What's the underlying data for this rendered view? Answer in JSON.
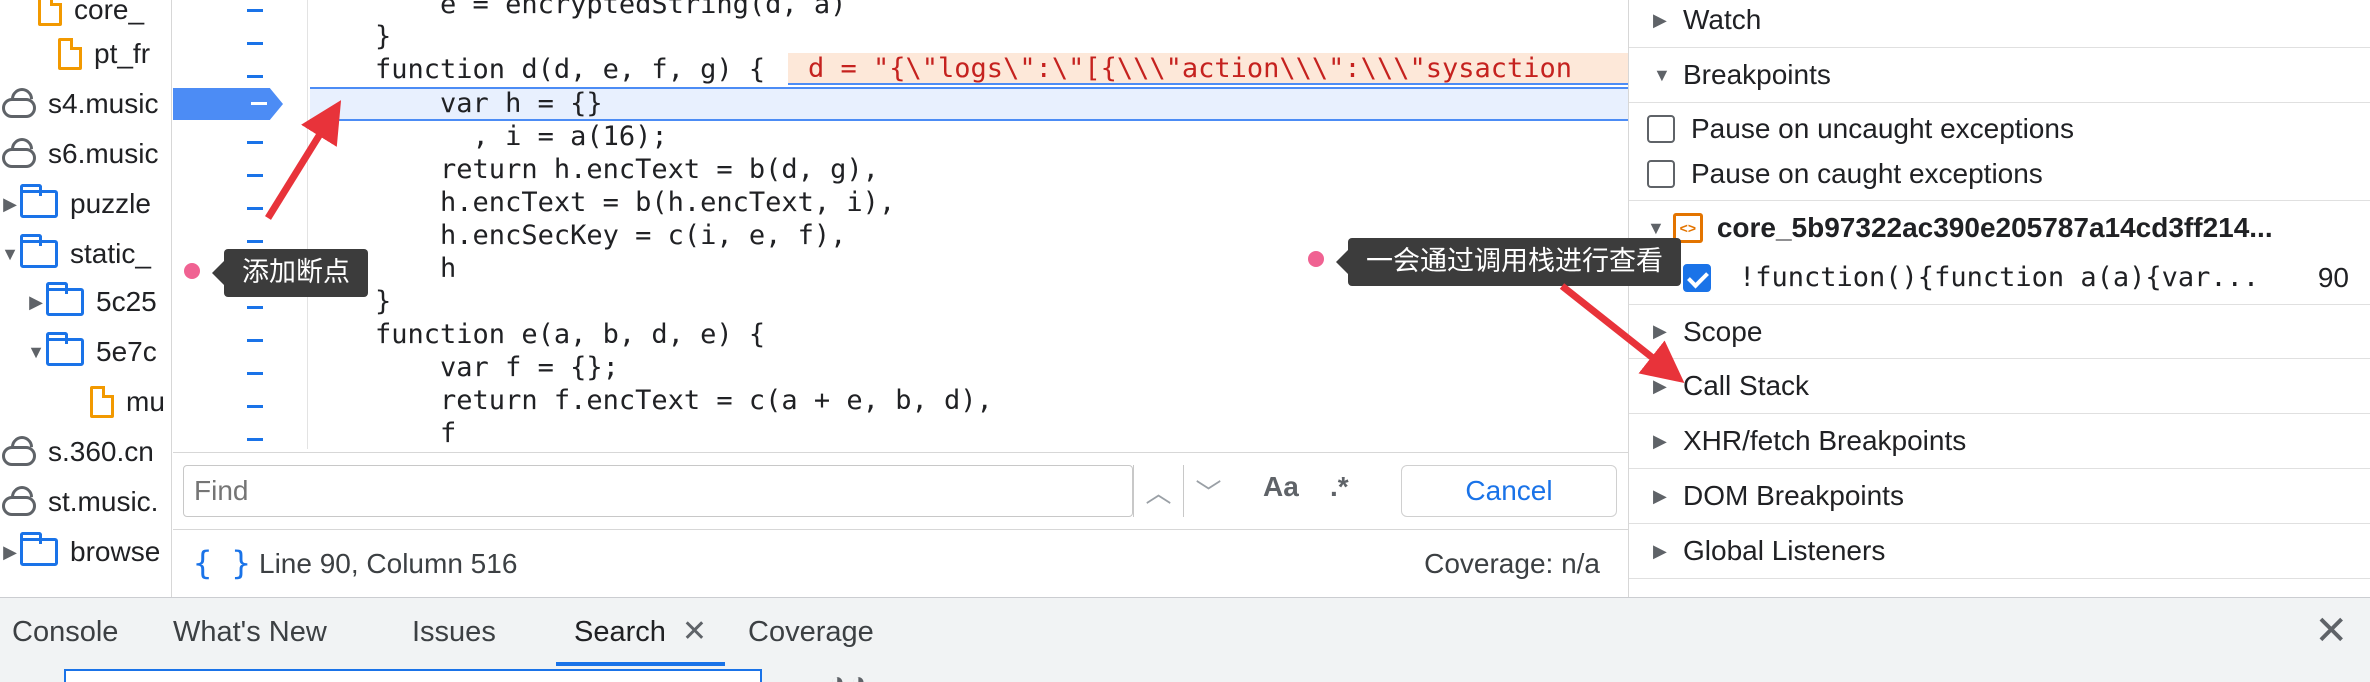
{
  "file_tree": {
    "items": [
      {
        "name": "core_",
        "kind": "file"
      },
      {
        "name": "pt_fr",
        "kind": "file"
      },
      {
        "name": "s4.music",
        "kind": "domain"
      },
      {
        "name": "s6.music",
        "kind": "domain"
      },
      {
        "name": "puzzle",
        "kind": "folder"
      },
      {
        "name": "static_",
        "kind": "folder"
      },
      {
        "name": "5c25",
        "kind": "folder"
      },
      {
        "name": "5e7c",
        "kind": "folder"
      },
      {
        "name": "mu",
        "kind": "file"
      },
      {
        "name": "s.360.cn",
        "kind": "domain"
      },
      {
        "name": "st.music.",
        "kind": "domain"
      },
      {
        "name": "browse",
        "kind": "folder"
      }
    ]
  },
  "editor": {
    "lines": [
      "        e = encryptedString(d, a)",
      "    }",
      "    function d(d, e, f, g) {",
      "        var h = {}",
      "          , i = a(16);",
      "        return h.encText = b(d, g),",
      "        h.encText = b(h.encText, i),",
      "        h.encSecKey = c(i, e, f),",
      "        h",
      "    }",
      "    function e(a, b, d, e) {",
      "        var f = {};",
      "        return f.encText = c(a + e, b, d),",
      "        f"
    ],
    "inline_value": "d = \"{\\\"logs\\\":\\\"[{\\\\\\\"action\\\\\\\":\\\\\\\"sysaction"
  },
  "find_bar": {
    "placeholder": "Find",
    "case_label": "Aa",
    "regex_label": ".*",
    "cancel_label": "Cancel"
  },
  "status_bar": {
    "braces_icon": "{ }",
    "position": "Line 90, Column 516",
    "coverage": "Coverage: n/a"
  },
  "debugger": {
    "watch": "Watch",
    "breakpoints": "Breakpoints",
    "pause_uncaught": "Pause on uncaught exceptions",
    "pause_caught": "Pause on caught exceptions",
    "breakpoint_file": "core_5b97322ac390e205787a14cd3ff214...",
    "breakpoint_code": "!function(){function a(a){var...",
    "breakpoint_line": "90",
    "scope": "Scope",
    "call_stack": "Call Stack",
    "xhr": "XHR/fetch Breakpoints",
    "dom": "DOM Breakpoints",
    "global": "Global Listeners"
  },
  "drawer": {
    "tabs": [
      "Console",
      "What's New",
      "Issues",
      "Search",
      "Coverage"
    ],
    "active_tab": "Search",
    "close_glyph": "✕"
  },
  "annotations": {
    "add_breakpoint": "添加断点",
    "view_call_stack": "一会通过调用栈进行查看"
  },
  "colors": {
    "accent": "#1a73e8",
    "breakpoint": "#4c8cf5",
    "arrow": "#e8333a",
    "inline_value_bg": "#fde8d9"
  }
}
